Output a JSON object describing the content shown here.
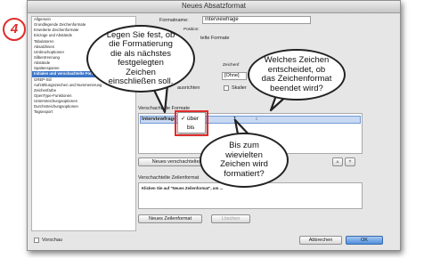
{
  "step_badge": "4",
  "window": {
    "title": "Neues Absatzformat"
  },
  "sidebar": {
    "items": [
      "Allgemein",
      "Grundlegende Zeichenformate",
      "Erweiterte Zeichenformate",
      "Einzüge und Abstände",
      "Tabulatoren",
      "Absatzlinien",
      "Umbruchoptionen",
      "Silbentrennung",
      "Abstände",
      "Spaltenspanne",
      "Initialen und verschachtelte Formate",
      "GREP-Stil",
      "Aufzählungszeichen und Nummerierung",
      "Zeichenfarbe",
      "OpenType-Funktionen",
      "Unterstreichungsoptionen",
      "Durchstreichungsoptionen",
      "Tagsexport"
    ],
    "selected_index": 10
  },
  "form": {
    "formatname_label": "Formatname:",
    "formatname_value": "Interviewfrage",
    "position_label": "Position:",
    "section_initial_suffix": "telte Formate",
    "zeichenformat_label": "Zeichenf",
    "zeichenformat_value": "[Ohne]",
    "ausrichten_label": "ausrichten",
    "skalieren_label": "Skalier"
  },
  "nested": {
    "header": "Verschachtelte Formate",
    "row": {
      "format": "Interviewfrage",
      "number": "1",
      "colon": ":"
    },
    "dropdown_options": [
      {
        "label": "über",
        "checked": true
      },
      {
        "label": "bis",
        "checked": false
      }
    ],
    "new_button": "Neues verschachteltes F"
  },
  "lines": {
    "header": "Verschachtelte Zeilenformat",
    "hint": "Klicken Sie auf \"Neues Zeilenformat\", um ...",
    "new_button": "Neues Zeilenformat",
    "delete_button": "Löschen"
  },
  "footer": {
    "preview_label": "Vorschau",
    "cancel": "Abbrechen",
    "ok": "OK"
  },
  "callouts": {
    "top": "Legen Sie fest, ob die Formatierung die als nächstes festgelegten Zeichen einschließen soll.",
    "right": "Welches Zeichen entscheidet, ob das Zeichenformat beendet wird?",
    "bottom": "Bis zum wievielten Zeichen wird formatiert?"
  },
  "colors": {
    "badge": "#e02c2c",
    "highlight_box": "#e02c2c",
    "selection": "#3c76c9"
  }
}
